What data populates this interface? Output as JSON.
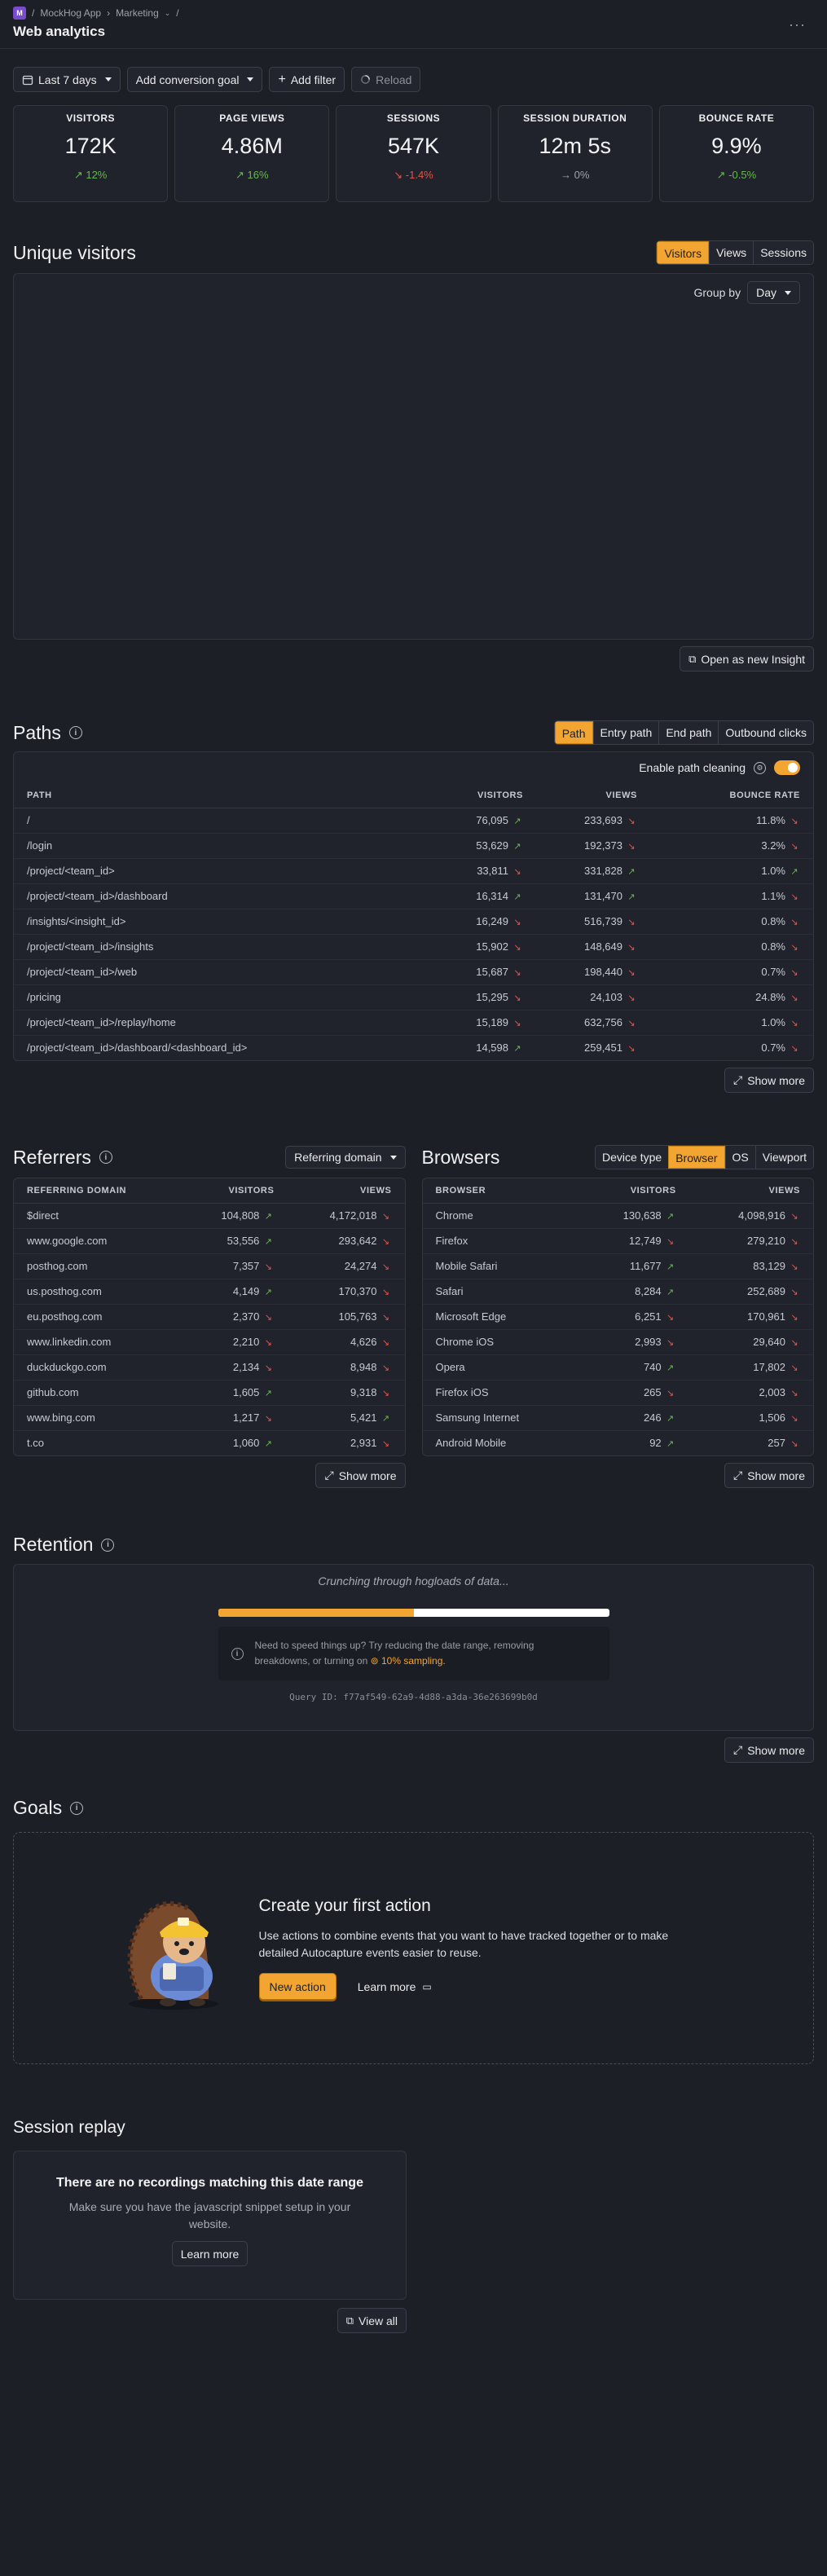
{
  "header": {
    "breadcrumb": [
      "MockHog App",
      "Marketing"
    ],
    "separator": "/",
    "org_initial": "M",
    "title": "Web analytics"
  },
  "filters": {
    "date_range": "Last 7 days",
    "conversion_goal": "Add conversion goal",
    "add_filter": "Add filter",
    "reload": "Reload"
  },
  "kpis": [
    {
      "label": "VISITORS",
      "value": "172K",
      "change": "12%",
      "trend": "up"
    },
    {
      "label": "PAGE VIEWS",
      "value": "4.86M",
      "change": "16%",
      "trend": "up"
    },
    {
      "label": "SESSIONS",
      "value": "547K",
      "change": "-1.4%",
      "trend": "down"
    },
    {
      "label": "SESSION DURATION",
      "value": "12m 5s",
      "change": "0%",
      "trend": "flat"
    },
    {
      "label": "BOUNCE RATE",
      "value": "9.9%",
      "change": "-0.5%",
      "trend": "up"
    }
  ],
  "unique_visitors": {
    "title": "Unique visitors",
    "tabs": [
      "Visitors",
      "Views",
      "Sessions"
    ],
    "active_tab": "Visitors",
    "group_by_label": "Group by",
    "group_by_value": "Day",
    "open_insight": "Open as new Insight"
  },
  "paths": {
    "title": "Paths",
    "tabs": [
      "Path",
      "Entry path",
      "End path",
      "Outbound clicks"
    ],
    "active_tab": "Path",
    "path_cleaning_label": "Enable path cleaning",
    "columns": [
      "PATH",
      "VISITORS",
      "VIEWS",
      "BOUNCE RATE"
    ],
    "rows": [
      {
        "path": "/",
        "visitors": "76,095",
        "vt": "up",
        "views": "233,693",
        "wt": "down",
        "bounce": "11.8%",
        "bt": "down"
      },
      {
        "path": "/login",
        "visitors": "53,629",
        "vt": "up",
        "views": "192,373",
        "wt": "down",
        "bounce": "3.2%",
        "bt": "down"
      },
      {
        "path": "/project/<team_id>",
        "visitors": "33,811",
        "vt": "down",
        "views": "331,828",
        "wt": "up",
        "bounce": "1.0%",
        "bt": "up"
      },
      {
        "path": "/project/<team_id>/dashboard",
        "visitors": "16,314",
        "vt": "up",
        "views": "131,470",
        "wt": "up",
        "bounce": "1.1%",
        "bt": "down"
      },
      {
        "path": "/insights/<insight_id>",
        "visitors": "16,249",
        "vt": "down",
        "views": "516,739",
        "wt": "down",
        "bounce": "0.8%",
        "bt": "down"
      },
      {
        "path": "/project/<team_id>/insights",
        "visitors": "15,902",
        "vt": "down",
        "views": "148,649",
        "wt": "down",
        "bounce": "0.8%",
        "bt": "down"
      },
      {
        "path": "/project/<team_id>/web",
        "visitors": "15,687",
        "vt": "down",
        "views": "198,440",
        "wt": "down",
        "bounce": "0.7%",
        "bt": "down"
      },
      {
        "path": "/pricing",
        "visitors": "15,295",
        "vt": "down",
        "views": "24,103",
        "wt": "down",
        "bounce": "24.8%",
        "bt": "down"
      },
      {
        "path": "/project/<team_id>/replay/home",
        "visitors": "15,189",
        "vt": "down",
        "views": "632,756",
        "wt": "down",
        "bounce": "1.0%",
        "bt": "down"
      },
      {
        "path": "/project/<team_id>/dashboard/<dashboard_id>",
        "visitors": "14,598",
        "vt": "up",
        "views": "259,451",
        "wt": "down",
        "bounce": "0.7%",
        "bt": "down"
      }
    ],
    "show_more": "Show more"
  },
  "referrers": {
    "title": "Referrers",
    "dropdown": "Referring domain",
    "columns": [
      "REFERRING DOMAIN",
      "VISITORS",
      "VIEWS"
    ],
    "rows": [
      {
        "name": "$direct",
        "visitors": "104,808",
        "vt": "up",
        "views": "4,172,018",
        "wt": "down"
      },
      {
        "name": "www.google.com",
        "visitors": "53,556",
        "vt": "up",
        "views": "293,642",
        "wt": "down"
      },
      {
        "name": "posthog.com",
        "visitors": "7,357",
        "vt": "down",
        "views": "24,274",
        "wt": "down"
      },
      {
        "name": "us.posthog.com",
        "visitors": "4,149",
        "vt": "up",
        "views": "170,370",
        "wt": "down"
      },
      {
        "name": "eu.posthog.com",
        "visitors": "2,370",
        "vt": "down",
        "views": "105,763",
        "wt": "down"
      },
      {
        "name": "www.linkedin.com",
        "visitors": "2,210",
        "vt": "down",
        "views": "4,626",
        "wt": "down"
      },
      {
        "name": "duckduckgo.com",
        "visitors": "2,134",
        "vt": "down",
        "views": "8,948",
        "wt": "down"
      },
      {
        "name": "github.com",
        "visitors": "1,605",
        "vt": "up",
        "views": "9,318",
        "wt": "down"
      },
      {
        "name": "www.bing.com",
        "visitors": "1,217",
        "vt": "down",
        "views": "5,421",
        "wt": "up"
      },
      {
        "name": "t.co",
        "visitors": "1,060",
        "vt": "up",
        "views": "2,931",
        "wt": "down"
      }
    ],
    "show_more": "Show more"
  },
  "browsers": {
    "title": "Browsers",
    "tabs": [
      "Device type",
      "Browser",
      "OS",
      "Viewport"
    ],
    "active_tab": "Browser",
    "columns": [
      "BROWSER",
      "VISITORS",
      "VIEWS"
    ],
    "rows": [
      {
        "name": "Chrome",
        "visitors": "130,638",
        "vt": "up",
        "views": "4,098,916",
        "wt": "down"
      },
      {
        "name": "Firefox",
        "visitors": "12,749",
        "vt": "down",
        "views": "279,210",
        "wt": "down"
      },
      {
        "name": "Mobile Safari",
        "visitors": "11,677",
        "vt": "up",
        "views": "83,129",
        "wt": "down"
      },
      {
        "name": "Safari",
        "visitors": "8,284",
        "vt": "up",
        "views": "252,689",
        "wt": "down"
      },
      {
        "name": "Microsoft Edge",
        "visitors": "6,251",
        "vt": "down",
        "views": "170,961",
        "wt": "down"
      },
      {
        "name": "Chrome iOS",
        "visitors": "2,993",
        "vt": "down",
        "views": "29,640",
        "wt": "down"
      },
      {
        "name": "Opera",
        "visitors": "740",
        "vt": "up",
        "views": "17,802",
        "wt": "down"
      },
      {
        "name": "Firefox iOS",
        "visitors": "265",
        "vt": "down",
        "views": "2,003",
        "wt": "down"
      },
      {
        "name": "Samsung Internet",
        "visitors": "246",
        "vt": "up",
        "views": "1,506",
        "wt": "down"
      },
      {
        "name": "Android Mobile",
        "visitors": "92",
        "vt": "up",
        "views": "257",
        "wt": "down"
      }
    ],
    "show_more": "Show more"
  },
  "retention": {
    "title": "Retention",
    "loading_text": "Crunching through hogloads of data...",
    "progress": 0.5,
    "hint_line1": "Need to speed things up? Try reducing the date range, removing",
    "hint_line2": "breakdowns, or turning on",
    "sampling_link": "10% sampling.",
    "query_id": "Query ID: f77af549-62a9-4d88-a3da-36e263699b0d",
    "show_more": "Show more"
  },
  "goals": {
    "title": "Goals",
    "empty_title": "Create your first action",
    "empty_desc_1": "Use actions to combine events that you want to have tracked together or to make",
    "empty_desc_2": "detailed Autocapture events easier to reuse.",
    "new_action": "New action",
    "learn_more": "Learn more"
  },
  "session_replay": {
    "title": "Session replay",
    "empty_title": "There are no recordings matching this date range",
    "empty_desc_1": "Make sure you have the javascript snippet setup in your",
    "empty_desc_2": "website.",
    "learn_more": "Learn more",
    "view_all": "View all"
  },
  "colors": {
    "accent": "#f3a531",
    "positive": "#64b94a",
    "negative": "#e45545",
    "background": "#1d1f27"
  }
}
